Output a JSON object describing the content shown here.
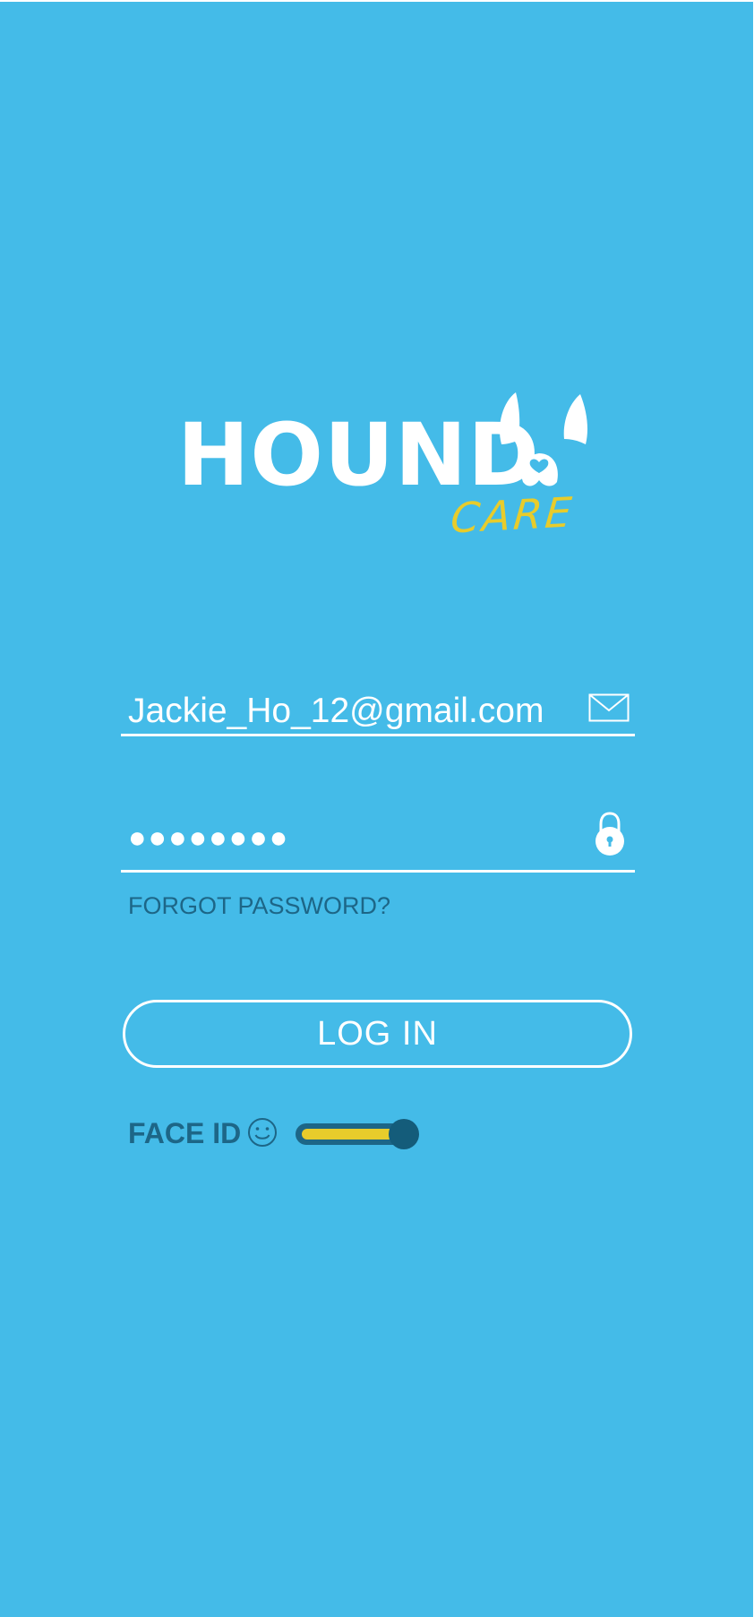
{
  "brand": {
    "name": "HOUND",
    "tagline": "CARE",
    "primary_color": "#44bbe8",
    "accent_color": "#e8cc2b",
    "dark_text_color": "#1d6687"
  },
  "login_form": {
    "email": {
      "value": "Jackie_Ho_12@gmail.com",
      "icon": "envelope-icon"
    },
    "password": {
      "value": "●●●●●●●●",
      "icon": "lock-icon"
    },
    "forgot_password_label": "FORGOT PASSWORD?",
    "login_button_label": "LOG IN",
    "face_id": {
      "label": "FACE ID",
      "icon": "smiley-face-icon",
      "enabled": true
    }
  }
}
